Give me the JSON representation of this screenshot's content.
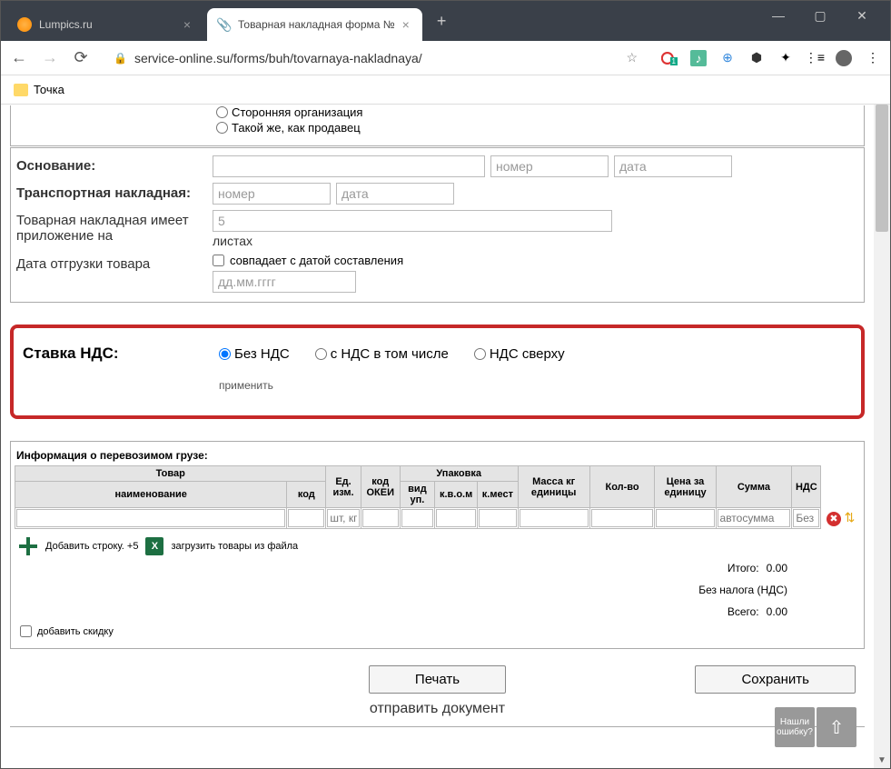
{
  "tabs": [
    {
      "title": "Lumpics.ru"
    },
    {
      "title": "Товарная накладная форма №"
    }
  ],
  "url": "service-online.su/forms/buh/tovarnaya-nakladnaya/",
  "bookmark": "Точка",
  "payer_radio": {
    "opt1": "Сторонняя организация",
    "opt2": "Такой же, как продавец"
  },
  "basis": {
    "label": "Основание:",
    "num_ph": "номер",
    "date_ph": "дата"
  },
  "transport": {
    "label": "Транспортная накладная:",
    "num_ph": "номер",
    "date_ph": "дата"
  },
  "attachment": {
    "label": "Товарная накладная имеет приложение на",
    "value": "5",
    "unit": "листах"
  },
  "ship_date": {
    "label": "Дата отгрузки товара",
    "same": "совпадает с датой составления",
    "ph": "дд.мм.гггг"
  },
  "nds": {
    "label": "Ставка НДС:",
    "o1": "Без НДС",
    "o2": "с НДС в том числе",
    "o3": "НДС сверху",
    "apply": "применить"
  },
  "cargo": {
    "title": "Информация о перевозимом грузе:",
    "h_goods": "Товар",
    "h_name": "наименование",
    "h_code": "код",
    "h_ed": "Ед. изм.",
    "h_okei": "код ОКЕИ",
    "h_pack": "Упаковка",
    "h_pack1": "вид уп.",
    "h_pack2": "к.в.о.м",
    "h_pack3": "к.мест",
    "h_mass": "Масса кг единицы",
    "h_qty": "Кол-во",
    "h_price": "Цена за единицу",
    "h_sum": "Сумма",
    "h_nds": "НДС",
    "ed_ph": "шт, кг",
    "sum_ph": "автосумма",
    "nds_ph": "Без",
    "add_row": "Добавить строку. +5",
    "load_file": "загрузить товары из файла",
    "totals_itogo": "Итого:",
    "totals_no_tax": "Без налога (НДС)",
    "totals_vsego": "Всего:",
    "zero": "0.00",
    "discount": "добавить скидку"
  },
  "footer": {
    "print": "Печать",
    "save": "Сохранить",
    "send": "отправить документ",
    "help": "Нашли ошибку?"
  }
}
